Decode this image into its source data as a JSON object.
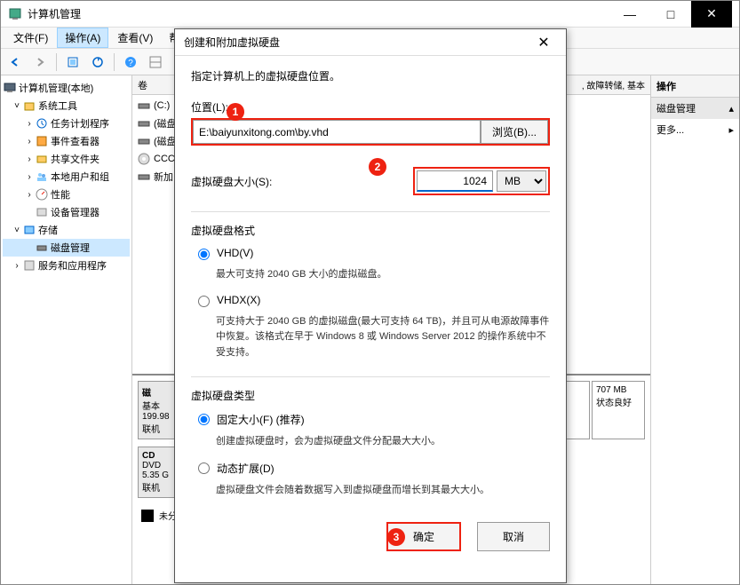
{
  "window": {
    "title": "计算机管理",
    "controls": {
      "min": "—",
      "max": "□",
      "close": "✕"
    }
  },
  "menubar": {
    "file": "文件(F)",
    "action": "操作(A)",
    "view": "查看(V)",
    "help": "帮"
  },
  "tree": {
    "root": "计算机管理(本地)",
    "systools": "系统工具",
    "scheduler": "任务计划程序",
    "eventviewer": "事件查看器",
    "shared": "共享文件夹",
    "users": "本地用户和组",
    "perf": "性能",
    "devmgr": "设备管理器",
    "storage": "存储",
    "diskmgmt": "磁盘管理",
    "services": "服务和应用程序"
  },
  "volumes": {
    "header": "卷",
    "items": [
      {
        "label": "(C:)"
      },
      {
        "label": "(磁盘"
      },
      {
        "label": "(磁盘"
      },
      {
        "label": "CCC("
      },
      {
        "label": "新加"
      }
    ],
    "extra_text": ", 故障转储, 基本"
  },
  "disk_section": {
    "disk_label": "磁",
    "disk_type": "基本",
    "disk_size": "199.98",
    "disk_status": "联机",
    "cd_label": "CD",
    "cd_type": "DVD",
    "cd_size": "5.35 G",
    "cd_status": "联机",
    "part_size": "707 MB",
    "part_status": "状态良好",
    "legend": "未分"
  },
  "right_panel": {
    "header": "操作",
    "diskmgmt": "磁盘管理",
    "more": "更多..."
  },
  "dialog": {
    "title": "创建和附加虚拟硬盘",
    "intro": "指定计算机上的虚拟硬盘位置。",
    "location_label": "位置(L):",
    "location_value": "E:\\baiyunxitong.com\\by.vhd",
    "browse": "浏览(B)...",
    "size_label": "虚拟硬盘大小(S):",
    "size_value": "1024",
    "size_unit": "MB",
    "format_group": "虚拟硬盘格式",
    "vhd_label": "VHD(V)",
    "vhd_desc": "最大可支持 2040 GB 大小的虚拟磁盘。",
    "vhdx_label": "VHDX(X)",
    "vhdx_desc": "可支持大于 2040 GB 的虚拟磁盘(最大可支持 64 TB)，并且可从电源故障事件中恢复。该格式在早于 Windows 8 或 Windows Server 2012 的操作系统中不受支持。",
    "type_group": "虚拟硬盘类型",
    "fixed_label": "固定大小(F) (推荐)",
    "fixed_desc": "创建虚拟硬盘时，会为虚拟硬盘文件分配最大大小。",
    "dynamic_label": "动态扩展(D)",
    "dynamic_desc": "虚拟硬盘文件会随着数据写入到虚拟硬盘而增长到其最大大小。",
    "ok": "确定",
    "cancel": "取消"
  },
  "annotations": {
    "a1": "1",
    "a2": "2",
    "a3": "3"
  }
}
